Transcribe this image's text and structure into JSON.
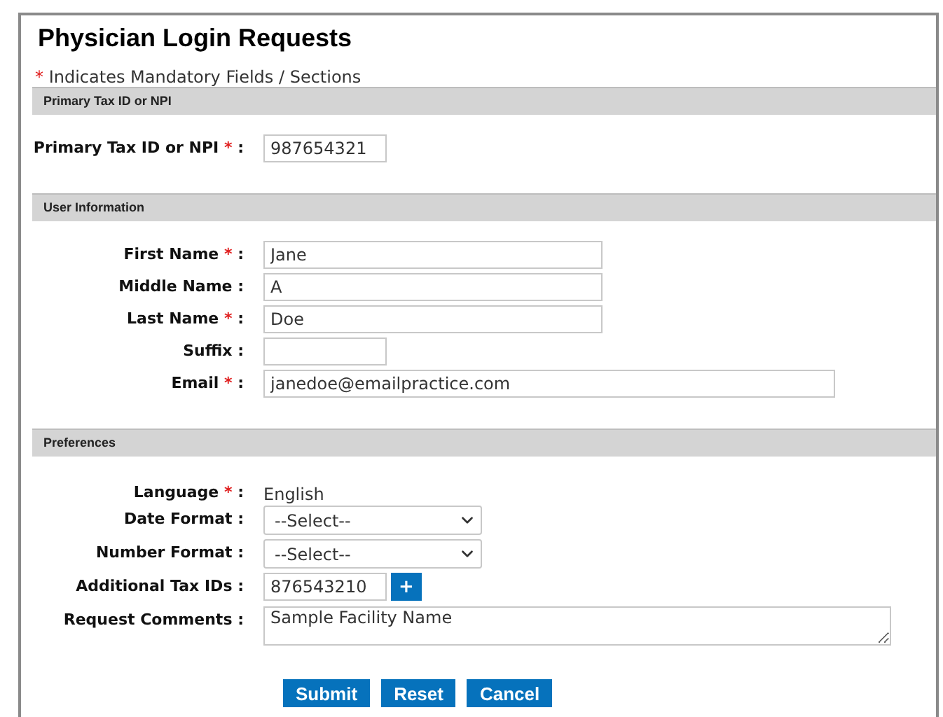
{
  "title": "Physician Login Requests",
  "mandatory_note": {
    "mark": "*",
    "text": "Indicates Mandatory Fields / Sections"
  },
  "sections": [
    {
      "title": "Primary Tax ID or NPI",
      "fields": [
        {
          "kind": "short",
          "label": "Primary Tax ID or NPI",
          "required_mark": "*",
          "colon": ":",
          "value": "987654321"
        }
      ]
    },
    {
      "title": "User Information",
      "fields": [
        {
          "kind": "medium",
          "label": "First Name",
          "required_mark": "*",
          "colon": ":",
          "value": "Jane"
        },
        {
          "kind": "medium",
          "label": "Middle Name",
          "colon": ":",
          "value": "A"
        },
        {
          "kind": "medium",
          "label": "Last Name",
          "required_mark": "*",
          "colon": ":",
          "value": "Doe"
        },
        {
          "kind": "short",
          "label": "Suffix",
          "colon": ":"
        },
        {
          "kind": "long",
          "label": "Email",
          "required_mark": "*",
          "colon": ":",
          "value": "janedoe@emailpractice.com"
        }
      ]
    },
    {
      "title": "Preferences",
      "fields": [
        {
          "kind": "static",
          "label": "Language",
          "required_mark": "*",
          "colon": ":",
          "value": "English"
        },
        {
          "kind": "select",
          "label": "Date Format",
          "colon": ":",
          "value": "--Select--"
        },
        {
          "kind": "select",
          "label": "Number Format",
          "colon": ":",
          "value": "--Select--"
        },
        {
          "kind": "add",
          "label": "Additional Tax IDs",
          "colon": ":",
          "value": "876543210",
          "button": "+"
        },
        {
          "kind": "textarea",
          "label": "Request Comments",
          "colon": ":",
          "value": "Sample Facility Name"
        }
      ]
    }
  ],
  "buttons": [
    "Submit",
    "Reset",
    "Cancel"
  ]
}
